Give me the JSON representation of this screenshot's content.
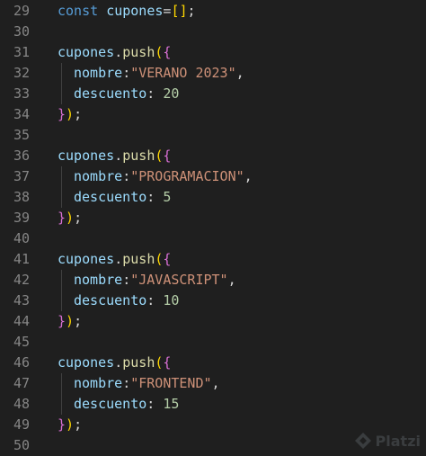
{
  "editor": {
    "lines": [
      {
        "number": "29",
        "indent": false,
        "tokens": [
          {
            "text": "const ",
            "type": "keyword"
          },
          {
            "text": "cupones",
            "type": "variable"
          },
          {
            "text": "=",
            "type": "punct"
          },
          {
            "text": "[]",
            "type": "bracket-1"
          },
          {
            "text": ";",
            "type": "punct"
          }
        ]
      },
      {
        "number": "30",
        "indent": false,
        "tokens": []
      },
      {
        "number": "31",
        "indent": false,
        "tokens": [
          {
            "text": "cupones",
            "type": "variable"
          },
          {
            "text": ".",
            "type": "punct"
          },
          {
            "text": "push",
            "type": "function"
          },
          {
            "text": "(",
            "type": "bracket-1"
          },
          {
            "text": "{",
            "type": "bracket-2"
          }
        ]
      },
      {
        "number": "32",
        "indent": true,
        "tokens": [
          {
            "text": "nombre",
            "type": "variable"
          },
          {
            "text": ":",
            "type": "punct"
          },
          {
            "text": "\"VERANO 2023\"",
            "type": "string"
          },
          {
            "text": ",",
            "type": "punct"
          }
        ]
      },
      {
        "number": "33",
        "indent": true,
        "tokens": [
          {
            "text": "descuento",
            "type": "variable"
          },
          {
            "text": ": ",
            "type": "punct"
          },
          {
            "text": "20",
            "type": "number"
          }
        ]
      },
      {
        "number": "34",
        "indent": false,
        "tokens": [
          {
            "text": "}",
            "type": "bracket-2"
          },
          {
            "text": ")",
            "type": "bracket-1"
          },
          {
            "text": ";",
            "type": "punct"
          }
        ]
      },
      {
        "number": "35",
        "indent": false,
        "tokens": []
      },
      {
        "number": "36",
        "indent": false,
        "tokens": [
          {
            "text": "cupones",
            "type": "variable"
          },
          {
            "text": ".",
            "type": "punct"
          },
          {
            "text": "push",
            "type": "function"
          },
          {
            "text": "(",
            "type": "bracket-1"
          },
          {
            "text": "{",
            "type": "bracket-2"
          }
        ]
      },
      {
        "number": "37",
        "indent": true,
        "tokens": [
          {
            "text": "nombre",
            "type": "variable"
          },
          {
            "text": ":",
            "type": "punct"
          },
          {
            "text": "\"PROGRAMACION\"",
            "type": "string"
          },
          {
            "text": ",",
            "type": "punct"
          }
        ]
      },
      {
        "number": "38",
        "indent": true,
        "tokens": [
          {
            "text": "descuento",
            "type": "variable"
          },
          {
            "text": ": ",
            "type": "punct"
          },
          {
            "text": "5",
            "type": "number"
          }
        ]
      },
      {
        "number": "39",
        "indent": false,
        "tokens": [
          {
            "text": "}",
            "type": "bracket-2"
          },
          {
            "text": ")",
            "type": "bracket-1"
          },
          {
            "text": ";",
            "type": "punct"
          }
        ]
      },
      {
        "number": "40",
        "indent": false,
        "tokens": []
      },
      {
        "number": "41",
        "indent": false,
        "tokens": [
          {
            "text": "cupones",
            "type": "variable"
          },
          {
            "text": ".",
            "type": "punct"
          },
          {
            "text": "push",
            "type": "function"
          },
          {
            "text": "(",
            "type": "bracket-1"
          },
          {
            "text": "{",
            "type": "bracket-2"
          }
        ]
      },
      {
        "number": "42",
        "indent": true,
        "tokens": [
          {
            "text": "nombre",
            "type": "variable"
          },
          {
            "text": ":",
            "type": "punct"
          },
          {
            "text": "\"JAVASCRIPT\"",
            "type": "string"
          },
          {
            "text": ",",
            "type": "punct"
          }
        ]
      },
      {
        "number": "43",
        "indent": true,
        "tokens": [
          {
            "text": "descuento",
            "type": "variable"
          },
          {
            "text": ": ",
            "type": "punct"
          },
          {
            "text": "10",
            "type": "number"
          }
        ]
      },
      {
        "number": "44",
        "indent": false,
        "tokens": [
          {
            "text": "}",
            "type": "bracket-2"
          },
          {
            "text": ")",
            "type": "bracket-1"
          },
          {
            "text": ";",
            "type": "punct"
          }
        ]
      },
      {
        "number": "45",
        "indent": false,
        "tokens": []
      },
      {
        "number": "46",
        "indent": false,
        "tokens": [
          {
            "text": "cupones",
            "type": "variable"
          },
          {
            "text": ".",
            "type": "punct"
          },
          {
            "text": "push",
            "type": "function"
          },
          {
            "text": "(",
            "type": "bracket-1"
          },
          {
            "text": "{",
            "type": "bracket-2"
          }
        ]
      },
      {
        "number": "47",
        "indent": true,
        "tokens": [
          {
            "text": "nombre",
            "type": "variable"
          },
          {
            "text": ":",
            "type": "punct"
          },
          {
            "text": "\"FRONTEND\"",
            "type": "string"
          },
          {
            "text": ",",
            "type": "punct"
          }
        ]
      },
      {
        "number": "48",
        "indent": true,
        "tokens": [
          {
            "text": "descuento",
            "type": "variable"
          },
          {
            "text": ": ",
            "type": "punct"
          },
          {
            "text": "15",
            "type": "number"
          }
        ]
      },
      {
        "number": "49",
        "indent": false,
        "tokens": [
          {
            "text": "}",
            "type": "bracket-2"
          },
          {
            "text": ")",
            "type": "bracket-1"
          },
          {
            "text": ";",
            "type": "punct"
          }
        ]
      },
      {
        "number": "50",
        "indent": false,
        "tokens": []
      }
    ]
  },
  "watermark": {
    "text": "Platzi",
    "icon": "platzi-logo-icon"
  }
}
